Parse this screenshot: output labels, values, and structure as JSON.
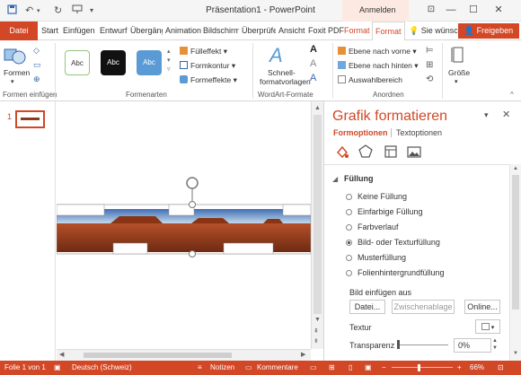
{
  "window": {
    "title": "Präsentation1 - PowerPoint",
    "context_tab_group": "Anmelden",
    "controls": {
      "help": "?",
      "restore": "❐",
      "minimize": "—",
      "maximize": "☐",
      "close": "✕"
    }
  },
  "tabs": {
    "file": "Datei",
    "items": [
      "Start",
      "Einfügen",
      "Entwurf",
      "Übergänge",
      "Animationen",
      "Bildschirm",
      "Überprüfen",
      "Ansicht",
      "Foxit PDF"
    ],
    "context_items": [
      "Format",
      "Format"
    ],
    "tell_me": "Sie wünschen",
    "share": "Freigeben"
  },
  "ribbon": {
    "insert_shapes": {
      "label": "Formen einfügen",
      "shapes_button": "Formen"
    },
    "shape_styles": {
      "label": "Formenarten",
      "style_samples": [
        "Abc",
        "Abc",
        "Abc"
      ],
      "fill": "Fülleffekt",
      "outline": "Formkontur",
      "effects": "Formeffekte"
    },
    "wordart": {
      "label": "WordArt-Formate",
      "quick_styles_1": "Schnell-",
      "quick_styles_2": "formatvorlagen"
    },
    "arrange": {
      "label": "Anordnen",
      "bring_forward": "Ebene nach vorne",
      "send_backward": "Ebene nach hinten",
      "selection_pane": "Auswahlbereich"
    },
    "size": {
      "label": "Größe"
    }
  },
  "thumbnails": {
    "slide_number": "1"
  },
  "format_pane": {
    "title": "Grafik formatieren",
    "tabs": [
      "Formoptionen",
      "Textoptionen"
    ],
    "section": "Füllung",
    "fill_options": [
      {
        "label": "Keine Füllung",
        "selected": false
      },
      {
        "label": "Einfarbige Füllung",
        "selected": false
      },
      {
        "label": "Farbverlauf",
        "selected": false
      },
      {
        "label": "Bild- oder Texturfüllung",
        "selected": true
      },
      {
        "label": "Musterfüllung",
        "selected": false
      },
      {
        "label": "Folienhintergrundfüllung",
        "selected": false
      }
    ],
    "insert_picture_label": "Bild einfügen aus",
    "file_button": "Datei...",
    "clipboard_button": "Zwischenablage",
    "online_button": "Online...",
    "texture_label": "Textur",
    "transparency_label": "Transparenz",
    "transparency_value": "0%"
  },
  "status": {
    "slide": "Folie 1 von 1",
    "language": "Deutsch (Schweiz)",
    "notes": "Notizen",
    "comments": "Kommentare",
    "zoom": "66%"
  },
  "colors": {
    "accent": "#d24726",
    "status_bar": "#d24726"
  }
}
